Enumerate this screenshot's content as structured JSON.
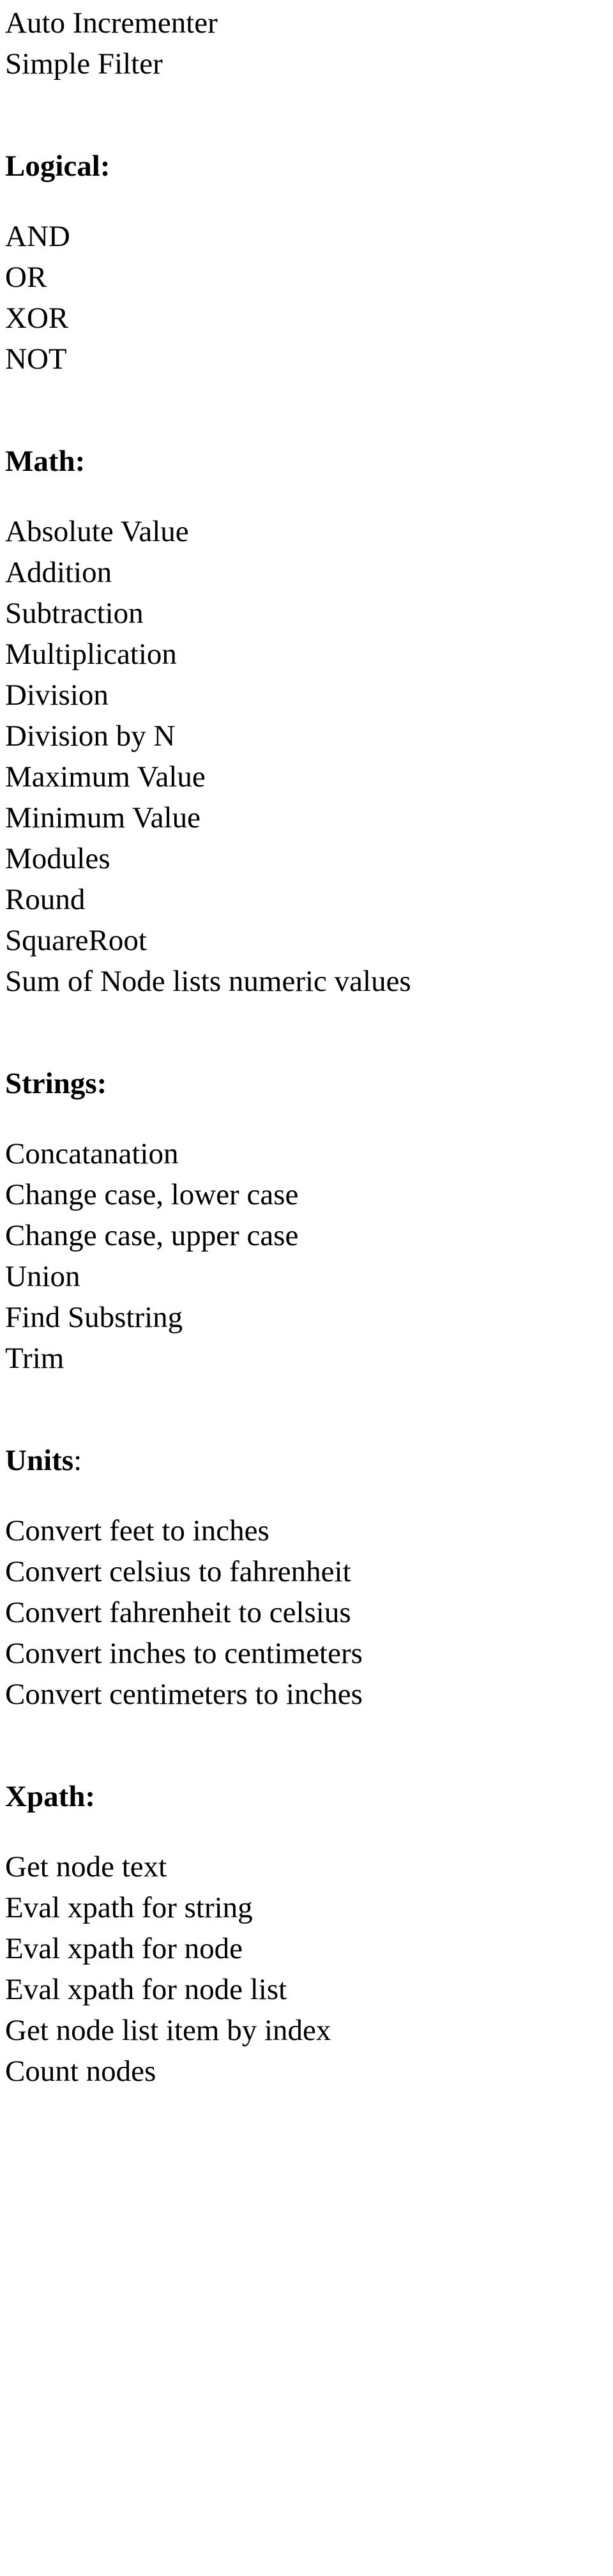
{
  "document": {
    "text_color": "#000000",
    "background_color": "#ffffff",
    "intro_lines": [
      "Auto Incrementer",
      "Simple Filter"
    ],
    "sections": [
      {
        "heading": "Logical:",
        "heading_colon_separate": false,
        "items": [
          "AND",
          "OR",
          "XOR",
          "NOT"
        ]
      },
      {
        "heading": "Math:",
        "heading_colon_separate": false,
        "items": [
          "Absolute Value",
          "Addition",
          "Subtraction",
          "Multiplication",
          "Division",
          "Division by N",
          "Maximum Value",
          "Minimum Value",
          "Modules",
          "Round",
          "SquareRoot",
          "Sum of Node lists numeric values"
        ]
      },
      {
        "heading": "Strings:",
        "heading_colon_separate": false,
        "items": [
          "Concatanation",
          "Change case, lower case",
          "Change case, upper case",
          "Union",
          "Find Substring",
          "Trim"
        ]
      },
      {
        "heading": "Units",
        "heading_colon": ":",
        "heading_colon_separate": true,
        "items": [
          "Convert feet to inches",
          "Convert celsius to fahrenheit",
          "Convert fahrenheit to celsius",
          "Convert inches to centimeters",
          "Convert centimeters to inches"
        ]
      },
      {
        "heading": "Xpath:",
        "heading_colon_separate": false,
        "items": [
          "Get node text",
          "Eval xpath for string",
          "Eval xpath for node",
          "Eval xpath for node list",
          "Get node list item by index",
          "Count nodes"
        ]
      }
    ]
  }
}
